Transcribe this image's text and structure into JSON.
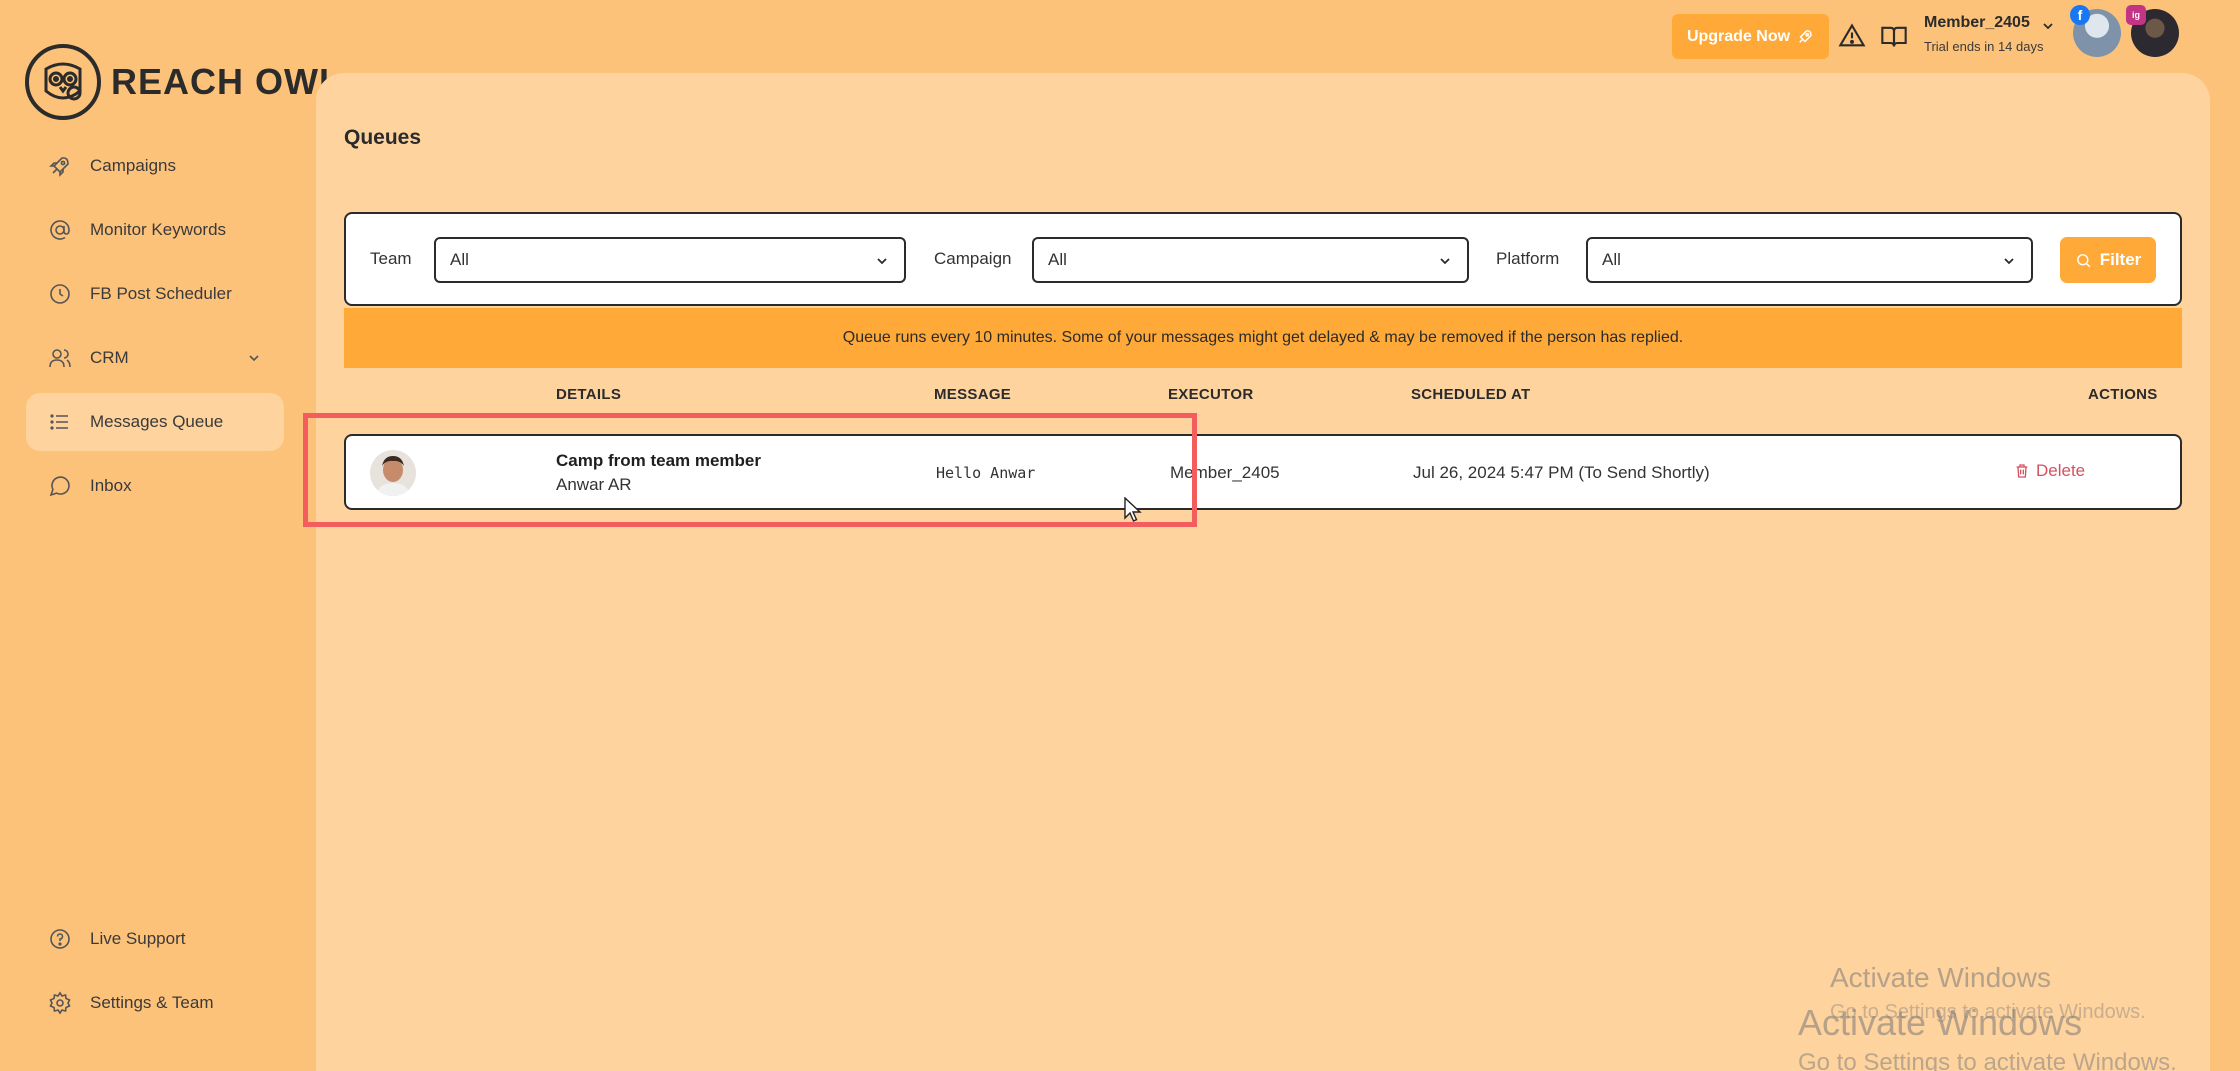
{
  "brand": {
    "name": "REACH OWL"
  },
  "sidebar": {
    "items": [
      {
        "label": "Campaigns",
        "icon": "rocket-icon"
      },
      {
        "label": "Monitor Keywords",
        "icon": "at-sign-icon"
      },
      {
        "label": "FB Post Scheduler",
        "icon": "clock-icon"
      },
      {
        "label": "CRM",
        "icon": "users-icon"
      },
      {
        "label": "Messages Queue",
        "icon": "list-icon",
        "active": true
      },
      {
        "label": "Inbox",
        "icon": "chat-bubble-icon"
      }
    ],
    "bottom": [
      {
        "label": "Live Support",
        "icon": "help-circle-icon"
      },
      {
        "label": "Settings & Team",
        "icon": "gear-icon"
      }
    ]
  },
  "header": {
    "upgrade_label": "Upgrade Now",
    "user_name": "Member_2405",
    "trial_text": "Trial ends in 14 days",
    "social": [
      "f",
      "ig"
    ]
  },
  "page": {
    "title": "Queues"
  },
  "filters": {
    "team_label": "Team",
    "team_value": "All",
    "campaign_label": "Campaign",
    "campaign_value": "All",
    "platform_label": "Platform",
    "platform_value": "All",
    "filter_button": "Filter"
  },
  "notice": "Queue runs every 10 minutes. Some of your messages might get delayed & may be removed if the person has replied.",
  "table": {
    "headers": {
      "details": "DETAILS",
      "message": "MESSAGE",
      "executor": "EXECUTOR",
      "scheduled": "SCHEDULED AT",
      "actions": "ACTIONS"
    },
    "rows": [
      {
        "campaign": "Camp from team member",
        "contact": "Anwar AR",
        "message": "Hello Anwar",
        "executor": "Member_2405",
        "scheduled": "Jul 26, 2024 5:47 PM (To Send Shortly)",
        "action": "Delete"
      }
    ]
  },
  "watermark": {
    "line1": "Activate Windows",
    "line2": "Go to Settings to activate Windows."
  },
  "colors": {
    "accent": "#fea938",
    "page_bg": "#fdc27a",
    "panel_bg": "#fed39e",
    "delete": "#d4525e",
    "highlight": "#f35d5d"
  }
}
